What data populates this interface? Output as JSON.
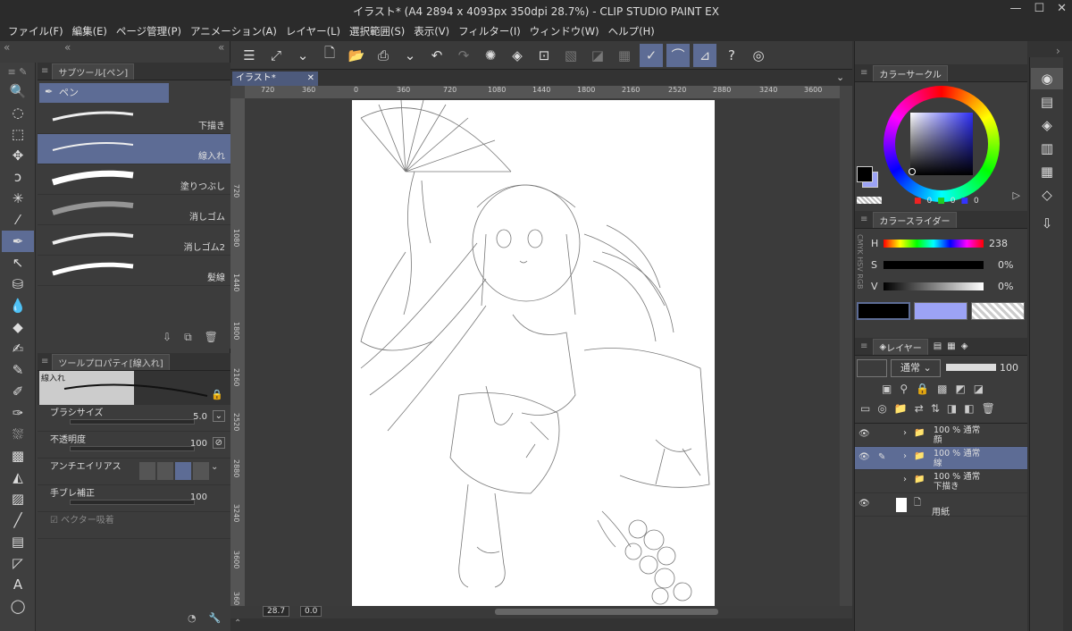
{
  "window": {
    "title": "イラスト* (A4 2894 x 4093px 350dpi 28.7%) - CLIP STUDIO PAINT EX"
  },
  "menu": [
    "ファイル(F)",
    "編集(E)",
    "ページ管理(P)",
    "アニメーション(A)",
    "レイヤー(L)",
    "選択範囲(S)",
    "表示(V)",
    "フィルター(I)",
    "ウィンドウ(W)",
    "ヘルプ(H)"
  ],
  "subtool": {
    "title": "サブツール[ペン]",
    "group": "ペン",
    "brushes": [
      "下描き",
      "線入れ",
      "塗りつぶし",
      "消しゴム",
      "消しゴム2",
      "髪線"
    ]
  },
  "toolprop": {
    "title": "ツールプロパティ[線入れ]",
    "preview_label": "線入れ",
    "brush_size_label": "ブラシサイズ",
    "brush_size": "5.0",
    "opacity_label": "不透明度",
    "opacity": "100",
    "antialias_label": "アンチエイリアス",
    "stabilization_label": "手ブレ補正",
    "stabilization": "100",
    "vector_label": "ベクター吸着"
  },
  "canvas": {
    "tab": "イラスト*",
    "ruler_h": [
      "720",
      "360",
      "0",
      "360",
      "720",
      "1080",
      "1440",
      "1800",
      "2160",
      "2520",
      "2880",
      "3240",
      "3600"
    ],
    "ruler_v": [
      "720",
      "1080",
      "1440",
      "1800",
      "2160",
      "2520",
      "2880",
      "3240",
      "3600",
      "360"
    ],
    "zoom": "28.7",
    "angle": "0.0"
  },
  "colorwheel": {
    "title": "カラーサークル",
    "r": "0",
    "g": "0",
    "b": "0"
  },
  "colorslider": {
    "title": "カラースライダー",
    "h_label": "H",
    "h": "238",
    "s_label": "S",
    "s": "0%",
    "v_label": "V",
    "v": "0%",
    "modes": "CMYK HSV RGB"
  },
  "layers": {
    "title": "レイヤー",
    "blend": "通常",
    "opacity": "100",
    "items": [
      {
        "mode": "100 % 通常",
        "name": "顔"
      },
      {
        "mode": "100 % 通常",
        "name": "線"
      },
      {
        "mode": "100 % 通常",
        "name": "下描き"
      },
      {
        "mode": "",
        "name": "用紙"
      }
    ]
  },
  "colors": {
    "accent": "#5d6c95",
    "main_color": "#000000",
    "sub_color": "#9ca3f5"
  }
}
